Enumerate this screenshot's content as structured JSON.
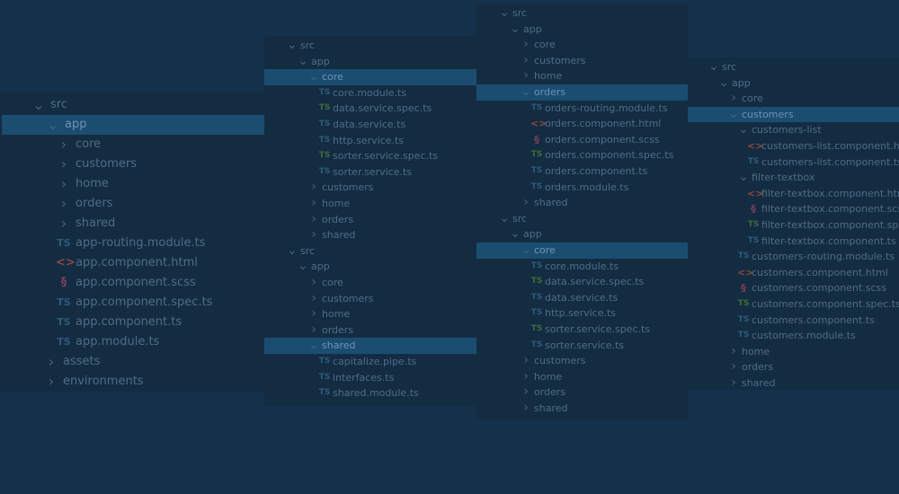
{
  "colors": {
    "background": "#15304a",
    "panel": "#142c42",
    "selected_row": "#1b4d70",
    "text": "#4f6c86",
    "ts_icon": "#2d5b7a",
    "spec_icon": "#3f6a3e",
    "html_icon": "#8a4a3c",
    "scss_icon": "#7a3f5a"
  },
  "icon_glyphs": {
    "chevron-right": "›",
    "chevron-down": "⌄",
    "ts": "TS",
    "html": "<>",
    "scss": "§"
  },
  "panels": [
    {
      "id": "explorer-panel-1",
      "rows": [
        {
          "label": "src",
          "icon": "chevron-down",
          "indent": 0
        },
        {
          "label": "app",
          "icon": "chevron-down",
          "indent": 1,
          "selected": true
        },
        {
          "label": "core",
          "icon": "chevron-right",
          "indent": 2
        },
        {
          "label": "customers",
          "icon": "chevron-right",
          "indent": 2
        },
        {
          "label": "home",
          "icon": "chevron-right",
          "indent": 2
        },
        {
          "label": "orders",
          "icon": "chevron-right",
          "indent": 2
        },
        {
          "label": "shared",
          "icon": "chevron-right",
          "indent": 2
        },
        {
          "label": "app-routing.module.ts",
          "icon": "ts",
          "indent": 2
        },
        {
          "label": "app.component.html",
          "icon": "html",
          "indent": 2
        },
        {
          "label": "app.component.scss",
          "icon": "scss",
          "indent": 2
        },
        {
          "label": "app.component.spec.ts",
          "icon": "ts",
          "indent": 2
        },
        {
          "label": "app.component.ts",
          "icon": "ts",
          "indent": 2
        },
        {
          "label": "app.module.ts",
          "icon": "ts",
          "indent": 2
        },
        {
          "label": "assets",
          "icon": "chevron-right",
          "indent": 1
        },
        {
          "label": "environments",
          "icon": "chevron-right",
          "indent": 1
        }
      ]
    },
    {
      "id": "explorer-panel-2",
      "rows": [
        {
          "label": "src",
          "icon": "chevron-down",
          "indent": 0
        },
        {
          "label": "app",
          "icon": "chevron-down",
          "indent": 1
        },
        {
          "label": "core",
          "icon": "chevron-down",
          "indent": 2,
          "selected": true
        },
        {
          "label": "core.module.ts",
          "icon": "ts",
          "indent": 3
        },
        {
          "label": "data.service.spec.ts",
          "icon": "ts-test",
          "indent": 3
        },
        {
          "label": "data.service.ts",
          "icon": "ts",
          "indent": 3
        },
        {
          "label": "http.service.ts",
          "icon": "ts",
          "indent": 3
        },
        {
          "label": "sorter.service.spec.ts",
          "icon": "ts-test",
          "indent": 3
        },
        {
          "label": "sorter.service.ts",
          "icon": "ts",
          "indent": 3
        },
        {
          "label": "customers",
          "icon": "chevron-right",
          "indent": 2
        },
        {
          "label": "home",
          "icon": "chevron-right",
          "indent": 2
        },
        {
          "label": "orders",
          "icon": "chevron-right",
          "indent": 2
        },
        {
          "label": "shared",
          "icon": "chevron-right",
          "indent": 2
        },
        {
          "label": "src",
          "icon": "chevron-down",
          "indent": 0
        },
        {
          "label": "app",
          "icon": "chevron-down",
          "indent": 1
        },
        {
          "label": "core",
          "icon": "chevron-right",
          "indent": 2
        },
        {
          "label": "customers",
          "icon": "chevron-right",
          "indent": 2
        },
        {
          "label": "home",
          "icon": "chevron-right",
          "indent": 2
        },
        {
          "label": "orders",
          "icon": "chevron-right",
          "indent": 2
        },
        {
          "label": "shared",
          "icon": "chevron-down",
          "indent": 2,
          "selected": true
        },
        {
          "label": "capitalize.pipe.ts",
          "icon": "ts",
          "indent": 3
        },
        {
          "label": "interfaces.ts",
          "icon": "ts",
          "indent": 3
        },
        {
          "label": "shared.module.ts",
          "icon": "ts",
          "indent": 3
        }
      ]
    },
    {
      "id": "explorer-panel-3",
      "rows": [
        {
          "label": "src",
          "icon": "chevron-down",
          "indent": 0
        },
        {
          "label": "app",
          "icon": "chevron-down",
          "indent": 1
        },
        {
          "label": "core",
          "icon": "chevron-right",
          "indent": 2
        },
        {
          "label": "customers",
          "icon": "chevron-right",
          "indent": 2
        },
        {
          "label": "home",
          "icon": "chevron-right",
          "indent": 2
        },
        {
          "label": "orders",
          "icon": "chevron-down",
          "indent": 2,
          "selected": true
        },
        {
          "label": "orders-routing.module.ts",
          "icon": "ts",
          "indent": 3
        },
        {
          "label": "orders.component.html",
          "icon": "html",
          "indent": 3
        },
        {
          "label": "orders.component.scss",
          "icon": "scss",
          "indent": 3
        },
        {
          "label": "orders.component.spec.ts",
          "icon": "ts-test",
          "indent": 3
        },
        {
          "label": "orders.component.ts",
          "icon": "ts",
          "indent": 3
        },
        {
          "label": "orders.module.ts",
          "icon": "ts",
          "indent": 3
        },
        {
          "label": "shared",
          "icon": "chevron-right",
          "indent": 2
        },
        {
          "label": "src",
          "icon": "chevron-down",
          "indent": 0
        },
        {
          "label": "app",
          "icon": "chevron-down",
          "indent": 1
        },
        {
          "label": "core",
          "icon": "chevron-down",
          "indent": 2,
          "selected": true
        },
        {
          "label": "core.module.ts",
          "icon": "ts",
          "indent": 3
        },
        {
          "label": "data.service.spec.ts",
          "icon": "ts-test",
          "indent": 3
        },
        {
          "label": "data.service.ts",
          "icon": "ts",
          "indent": 3
        },
        {
          "label": "http.service.ts",
          "icon": "ts",
          "indent": 3
        },
        {
          "label": "sorter.service.spec.ts",
          "icon": "ts-test",
          "indent": 3
        },
        {
          "label": "sorter.service.ts",
          "icon": "ts",
          "indent": 3
        },
        {
          "label": "customers",
          "icon": "chevron-right",
          "indent": 2
        },
        {
          "label": "home",
          "icon": "chevron-right",
          "indent": 2
        },
        {
          "label": "orders",
          "icon": "chevron-right",
          "indent": 2
        },
        {
          "label": "shared",
          "icon": "chevron-right",
          "indent": 2
        }
      ]
    },
    {
      "id": "explorer-panel-4",
      "rows": [
        {
          "label": "src",
          "icon": "chevron-down",
          "indent": 0
        },
        {
          "label": "app",
          "icon": "chevron-down",
          "indent": 1
        },
        {
          "label": "core",
          "icon": "chevron-right",
          "indent": 2
        },
        {
          "label": "customers",
          "icon": "chevron-down",
          "indent": 2,
          "selected": true
        },
        {
          "label": "customers-list",
          "icon": "chevron-down",
          "indent": 3
        },
        {
          "label": "customers-list.component.html",
          "icon": "html",
          "indent": 4
        },
        {
          "label": "customers-list.component.ts",
          "icon": "ts",
          "indent": 4
        },
        {
          "label": "filter-textbox",
          "icon": "chevron-down",
          "indent": 3
        },
        {
          "label": "filter-textbox.component.html",
          "icon": "html",
          "indent": 4
        },
        {
          "label": "filter-textbox.component.scss",
          "icon": "scss",
          "indent": 4
        },
        {
          "label": "filter-textbox.component.spec.ts",
          "icon": "ts-test",
          "indent": 4
        },
        {
          "label": "filter-textbox.component.ts",
          "icon": "ts",
          "indent": 4
        },
        {
          "label": "customers-routing.module.ts",
          "icon": "ts",
          "indent": 3
        },
        {
          "label": "customers.component.html",
          "icon": "html",
          "indent": 3
        },
        {
          "label": "customers.component.scss",
          "icon": "scss",
          "indent": 3
        },
        {
          "label": "customers.component.spec.ts",
          "icon": "ts-test",
          "indent": 3
        },
        {
          "label": "customers.component.ts",
          "icon": "ts",
          "indent": 3
        },
        {
          "label": "customers.module.ts",
          "icon": "ts",
          "indent": 3
        },
        {
          "label": "home",
          "icon": "chevron-right",
          "indent": 2
        },
        {
          "label": "orders",
          "icon": "chevron-right",
          "indent": 2
        },
        {
          "label": "shared",
          "icon": "chevron-right",
          "indent": 2
        }
      ]
    }
  ]
}
